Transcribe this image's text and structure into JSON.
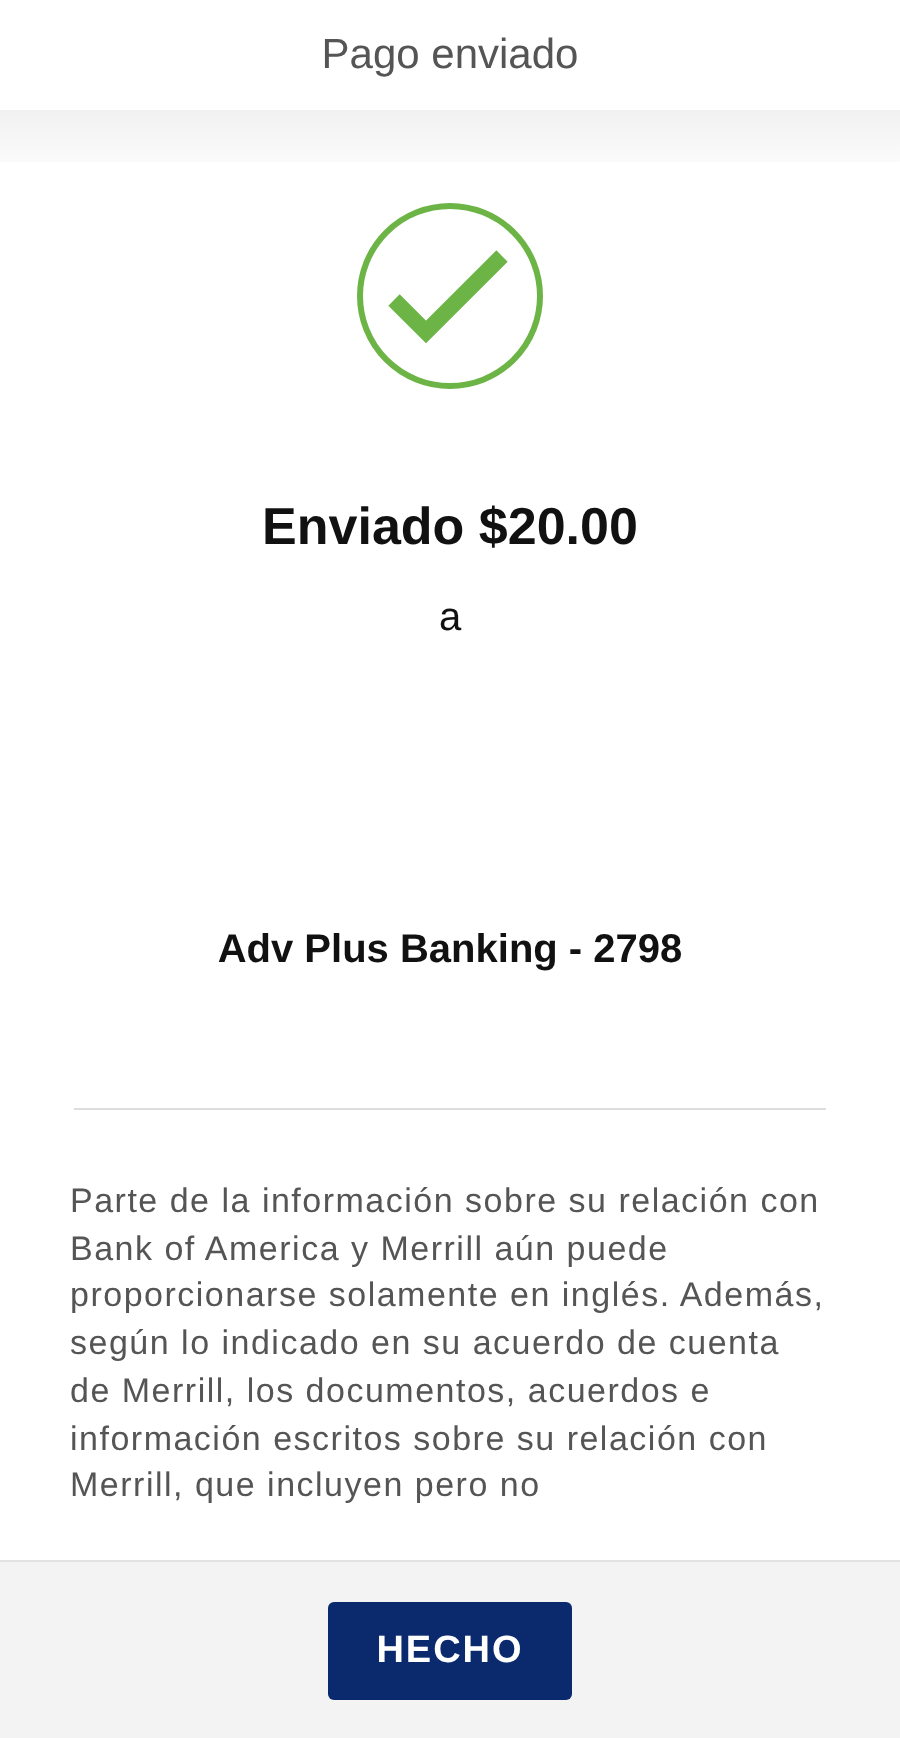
{
  "header": {
    "title": "Pago enviado"
  },
  "confirmation": {
    "success": true,
    "amount_line": "Enviado $20.00",
    "connector": "a",
    "account": "Adv Plus Banking - 2798"
  },
  "disclaimer": "Parte de la información sobre su relación con Bank of America y Merrill aún puede proporcionarse solamente en inglés. Además, según lo indicado en su acuerdo de cuenta de Merrill, los documentos, acuerdos e información escritos sobre su relación con Merrill, que incluyen pero no",
  "footer": {
    "button": "HECHO"
  }
}
